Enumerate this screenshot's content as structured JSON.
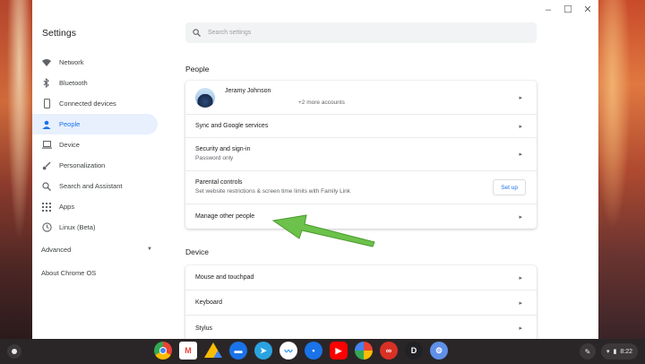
{
  "window": {
    "title": "Settings",
    "controls": [
      "–",
      "☐",
      "✕"
    ]
  },
  "search": {
    "placeholder": "Search settings"
  },
  "sidebar": {
    "items": [
      {
        "label": "Network",
        "icon": "wifi-icon"
      },
      {
        "label": "Bluetooth",
        "icon": "bluetooth-icon"
      },
      {
        "label": "Connected devices",
        "icon": "phone-icon"
      },
      {
        "label": "People",
        "icon": "person-icon",
        "active": true
      },
      {
        "label": "Device",
        "icon": "laptop-icon"
      },
      {
        "label": "Personalization",
        "icon": "brush-icon"
      },
      {
        "label": "Search and Assistant",
        "icon": "search-icon"
      },
      {
        "label": "Apps",
        "icon": "apps-grid-icon"
      },
      {
        "label": "Linux (Beta)",
        "icon": "linux-clock-icon"
      }
    ],
    "advanced": "Advanced",
    "about": "About Chrome OS"
  },
  "people": {
    "section_title": "People",
    "account": {
      "name": "Jeramy Johnson",
      "more": "+2 more accounts"
    },
    "sync": "Sync and Google services",
    "security": {
      "label": "Security and sign-in",
      "sub": "Password only"
    },
    "parental": {
      "label": "Parental controls",
      "sub": "Set website restrictions & screen time limits with Family Link",
      "button": "Set up"
    },
    "manage": "Manage other people"
  },
  "device": {
    "section_title": "Device",
    "rows": [
      "Mouse and touchpad",
      "Keyboard",
      "Stylus"
    ]
  },
  "shelf": {
    "apps": [
      "chrome-icon",
      "gmail-icon",
      "drive-icon",
      "files-icon",
      "telegram-icon",
      "messenger-icon",
      "messages-icon",
      "youtube-icon",
      "photos-icon",
      "app-red-icon",
      "app-dark-icon",
      "settings-icon"
    ],
    "time": "8:22"
  },
  "colors": {
    "accent": "#1a73e8",
    "annotation_arrow": "#5db83a"
  }
}
